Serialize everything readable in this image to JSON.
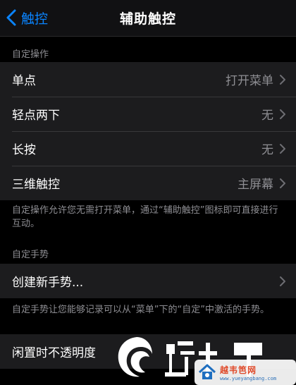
{
  "nav": {
    "back_label": "触控",
    "title": "辅助触控"
  },
  "custom_actions": {
    "header": "自定操作",
    "rows": [
      {
        "title": "单点",
        "value": "打开菜单"
      },
      {
        "title": "轻点两下",
        "value": "无"
      },
      {
        "title": "长按",
        "value": "无"
      },
      {
        "title": "三维触控",
        "value": "主屏幕"
      }
    ],
    "footer": "自定操作允许您无需打开菜单，通过“辅助触控”图标即可直接进行互动。"
  },
  "custom_gestures": {
    "header": "自定手势",
    "create_label": "创建新手势...",
    "footer": "自定手势让您能够记录可以从“菜单”下的“自定”中激活的手势。"
  },
  "idle_opacity": {
    "title": "闲置时不透明度"
  },
  "watermark": {
    "brand": "越韦笆网",
    "domain": "www.yueyangbang.com"
  },
  "colors": {
    "accent": "#0a84ff",
    "background": "#000000",
    "cell": "#1c1c1e",
    "secondary_text": "#8e8e93"
  }
}
